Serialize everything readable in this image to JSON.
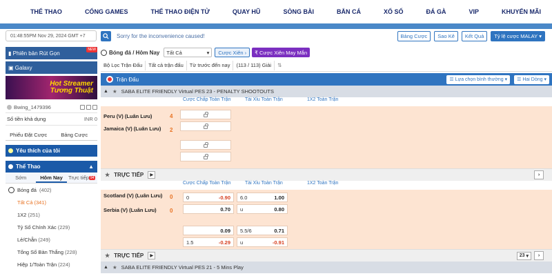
{
  "topnav": [
    "THỂ THAO",
    "CỔNG GAMES",
    "THỂ THAO ĐIỆN TỬ",
    "QUAY HŨ",
    "SÒNG BÀI",
    "BẮN CÁ",
    "XỔ SỐ",
    "ĐÁ GÀ",
    "VIP",
    "KHUYẾN MÃI"
  ],
  "subbar": {
    "datetime": "01:48:55PM Nov 29, 2024 GMT +7",
    "notice": "Sorry for the inconvenience caused!",
    "buttons": [
      "Bảng Cược",
      "Sao Kê",
      "Kết Quả"
    ],
    "odds_select": "Tỷ lệ cược MALAY"
  },
  "sidebar": {
    "banner1": "Phiên bản Rút Gọn",
    "banner1_badge": "NEW",
    "banner2": "Galaxy",
    "promo": "Hot Streamer Tương Thuật",
    "username": "Bwing_1479396",
    "balance_label": "Số tiền khả dụng",
    "balance_value": "INR 0",
    "tab_slip": "Phiếu Đặt Cược",
    "tab_bets": "Bảng Cược",
    "favorites": "Yêu thích của tôi",
    "sports": "Thể Thao",
    "subtabs": [
      "Sớm",
      "Hôm Nay",
      "Trực tiếp"
    ],
    "live_count": "94",
    "football": "Bóng đá",
    "football_count": "(402)",
    "items": [
      {
        "label": "Tất Cả",
        "count": "(341)"
      },
      {
        "label": "1X2",
        "count": "(251)"
      },
      {
        "label": "Tỷ Số Chính Xác",
        "count": "(229)"
      },
      {
        "label": "Lẻ/Chẵn",
        "count": "(249)"
      },
      {
        "label": "Tổng Số Bàn Thắng",
        "count": "(228)"
      },
      {
        "label": "Hiệp 1/Toàn Trận",
        "count": "(224)"
      }
    ]
  },
  "main": {
    "title": "Bóng đá / Hôm Nay",
    "filter_select": "Tất Cả",
    "parlay": "Cược Xiên",
    "parlay_lucky": "Cược Xiên May Mắn",
    "filters": [
      "Bộ Lọc Trận Đấu",
      "Tất cả trận đấu",
      "Từ trước đến nay",
      "(113 / 113) Giải"
    ],
    "section": "Trận Đấu",
    "sort1": "Lựa chọn bình thường",
    "sort2": "Hai Dòng",
    "league1": "SABA ELITE FRIENDLY Virtual PES 23 - PENALTY SHOOTOUTS",
    "cols": [
      "Cược Chấp Toàn Trận",
      "Tài Xỉu Toàn Trận",
      "1X2 Toàn Trận"
    ],
    "m1_home": "Peru (V) (Luân Lưu)",
    "m1_away": "Jamaica (V) (Luân Lưu)",
    "m1_hs": "4",
    "m1_as": "2",
    "live_label": "TRỰC TIẾP",
    "m2_home": "Scotland (V) (Luân Lưu)",
    "m2_away": "Serbia (V) (Luân Lưu)",
    "m2_hs": "0",
    "m2_as": "0",
    "odds": {
      "r1": [
        "0",
        "-0.90",
        "6.0",
        "1.00"
      ],
      "r2": [
        "",
        "0.70",
        "u",
        "0.80"
      ],
      "r3": [
        "",
        "0.09",
        "5.5/6",
        "0.71"
      ],
      "r4": [
        "1.5",
        "-0.29",
        "u",
        "-0.91"
      ]
    },
    "live_page": "23",
    "league2": "SABA ELITE FRIENDLY Virtual PES 21 - 5 Mins Play"
  }
}
